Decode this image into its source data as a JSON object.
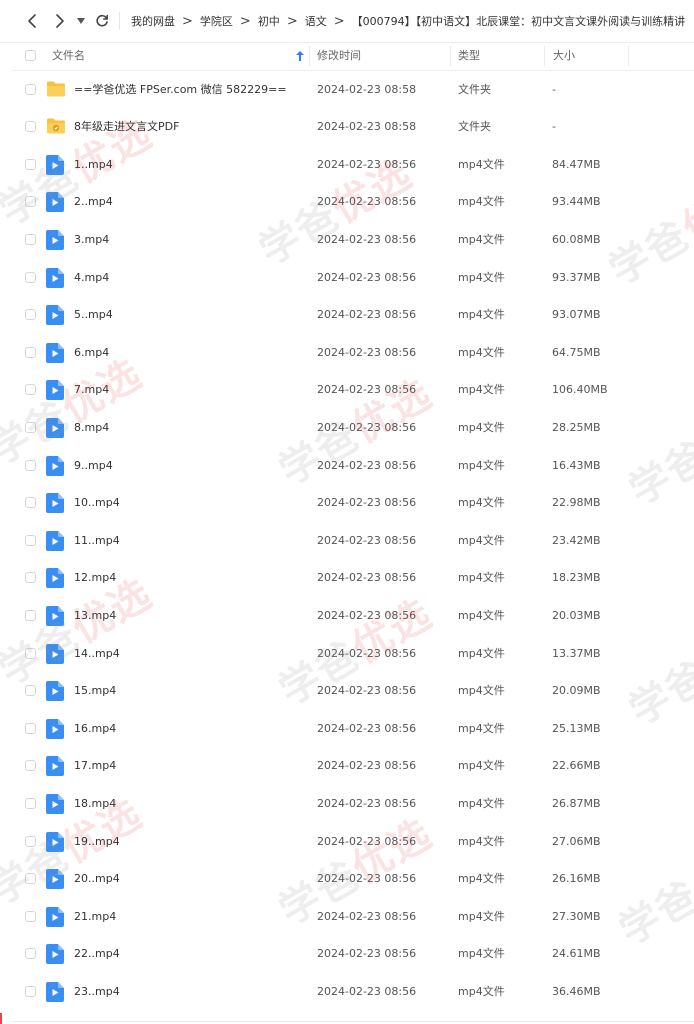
{
  "toolbar": {
    "breadcrumb": [
      "我的网盘",
      "学院区",
      "初中",
      "语文",
      "【000794】【初中语文】北辰课堂：初中文言文课外阅读与训练精讲"
    ]
  },
  "header": {
    "name": "文件名",
    "date": "修改时间",
    "type": "类型",
    "size": "大小"
  },
  "files": [
    {
      "name": "==学爸优选 FPSer.com 微信 582229==",
      "date": "2024-02-23 08:58",
      "type": "文件夹",
      "size": "-",
      "icon": "folder"
    },
    {
      "name": "8年级走进文言文PDF",
      "date": "2024-02-23 08:58",
      "type": "文件夹",
      "size": "-",
      "icon": "folder-badge"
    },
    {
      "name": "1..mp4",
      "date": "2024-02-23 08:56",
      "type": "mp4文件",
      "size": "84.47MB",
      "icon": "video"
    },
    {
      "name": "2..mp4",
      "date": "2024-02-23 08:56",
      "type": "mp4文件",
      "size": "93.44MB",
      "icon": "video"
    },
    {
      "name": "3.mp4",
      "date": "2024-02-23 08:56",
      "type": "mp4文件",
      "size": "60.08MB",
      "icon": "video"
    },
    {
      "name": "4.mp4",
      "date": "2024-02-23 08:56",
      "type": "mp4文件",
      "size": "93.37MB",
      "icon": "video"
    },
    {
      "name": "5..mp4",
      "date": "2024-02-23 08:56",
      "type": "mp4文件",
      "size": "93.07MB",
      "icon": "video"
    },
    {
      "name": "6.mp4",
      "date": "2024-02-23 08:56",
      "type": "mp4文件",
      "size": "64.75MB",
      "icon": "video"
    },
    {
      "name": "7.mp4",
      "date": "2024-02-23 08:56",
      "type": "mp4文件",
      "size": "106.40MB",
      "icon": "video"
    },
    {
      "name": "8.mp4",
      "date": "2024-02-23 08:56",
      "type": "mp4文件",
      "size": "28.25MB",
      "icon": "video"
    },
    {
      "name": "9..mp4",
      "date": "2024-02-23 08:56",
      "type": "mp4文件",
      "size": "16.43MB",
      "icon": "video"
    },
    {
      "name": "10..mp4",
      "date": "2024-02-23 08:56",
      "type": "mp4文件",
      "size": "22.98MB",
      "icon": "video"
    },
    {
      "name": "11..mp4",
      "date": "2024-02-23 08:56",
      "type": "mp4文件",
      "size": "23.42MB",
      "icon": "video"
    },
    {
      "name": "12.mp4",
      "date": "2024-02-23 08:56",
      "type": "mp4文件",
      "size": "18.23MB",
      "icon": "video"
    },
    {
      "name": "13.mp4",
      "date": "2024-02-23 08:56",
      "type": "mp4文件",
      "size": "20.03MB",
      "icon": "video"
    },
    {
      "name": "14..mp4",
      "date": "2024-02-23 08:56",
      "type": "mp4文件",
      "size": "13.37MB",
      "icon": "video"
    },
    {
      "name": "15.mp4",
      "date": "2024-02-23 08:56",
      "type": "mp4文件",
      "size": "20.09MB",
      "icon": "video"
    },
    {
      "name": "16.mp4",
      "date": "2024-02-23 08:56",
      "type": "mp4文件",
      "size": "25.13MB",
      "icon": "video"
    },
    {
      "name": "17.mp4",
      "date": "2024-02-23 08:56",
      "type": "mp4文件",
      "size": "22.66MB",
      "icon": "video"
    },
    {
      "name": "18.mp4",
      "date": "2024-02-23 08:56",
      "type": "mp4文件",
      "size": "26.87MB",
      "icon": "video"
    },
    {
      "name": "19..mp4",
      "date": "2024-02-23 08:56",
      "type": "mp4文件",
      "size": "27.06MB",
      "icon": "video"
    },
    {
      "name": "20..mp4",
      "date": "2024-02-23 08:56",
      "type": "mp4文件",
      "size": "26.16MB",
      "icon": "video"
    },
    {
      "name": "21.mp4",
      "date": "2024-02-23 08:56",
      "type": "mp4文件",
      "size": "27.30MB",
      "icon": "video"
    },
    {
      "name": "22..mp4",
      "date": "2024-02-23 08:56",
      "type": "mp4文件",
      "size": "24.61MB",
      "icon": "video"
    },
    {
      "name": "23..mp4",
      "date": "2024-02-23 08:56",
      "type": "mp4文件",
      "size": "36.46MB",
      "icon": "video"
    }
  ],
  "colors": {
    "folder": "#F7C33D",
    "video": "#3A8EF2",
    "accent": "#2F7DFF"
  },
  "watermark": {
    "text": "学爸",
    "highlight": "优选"
  }
}
